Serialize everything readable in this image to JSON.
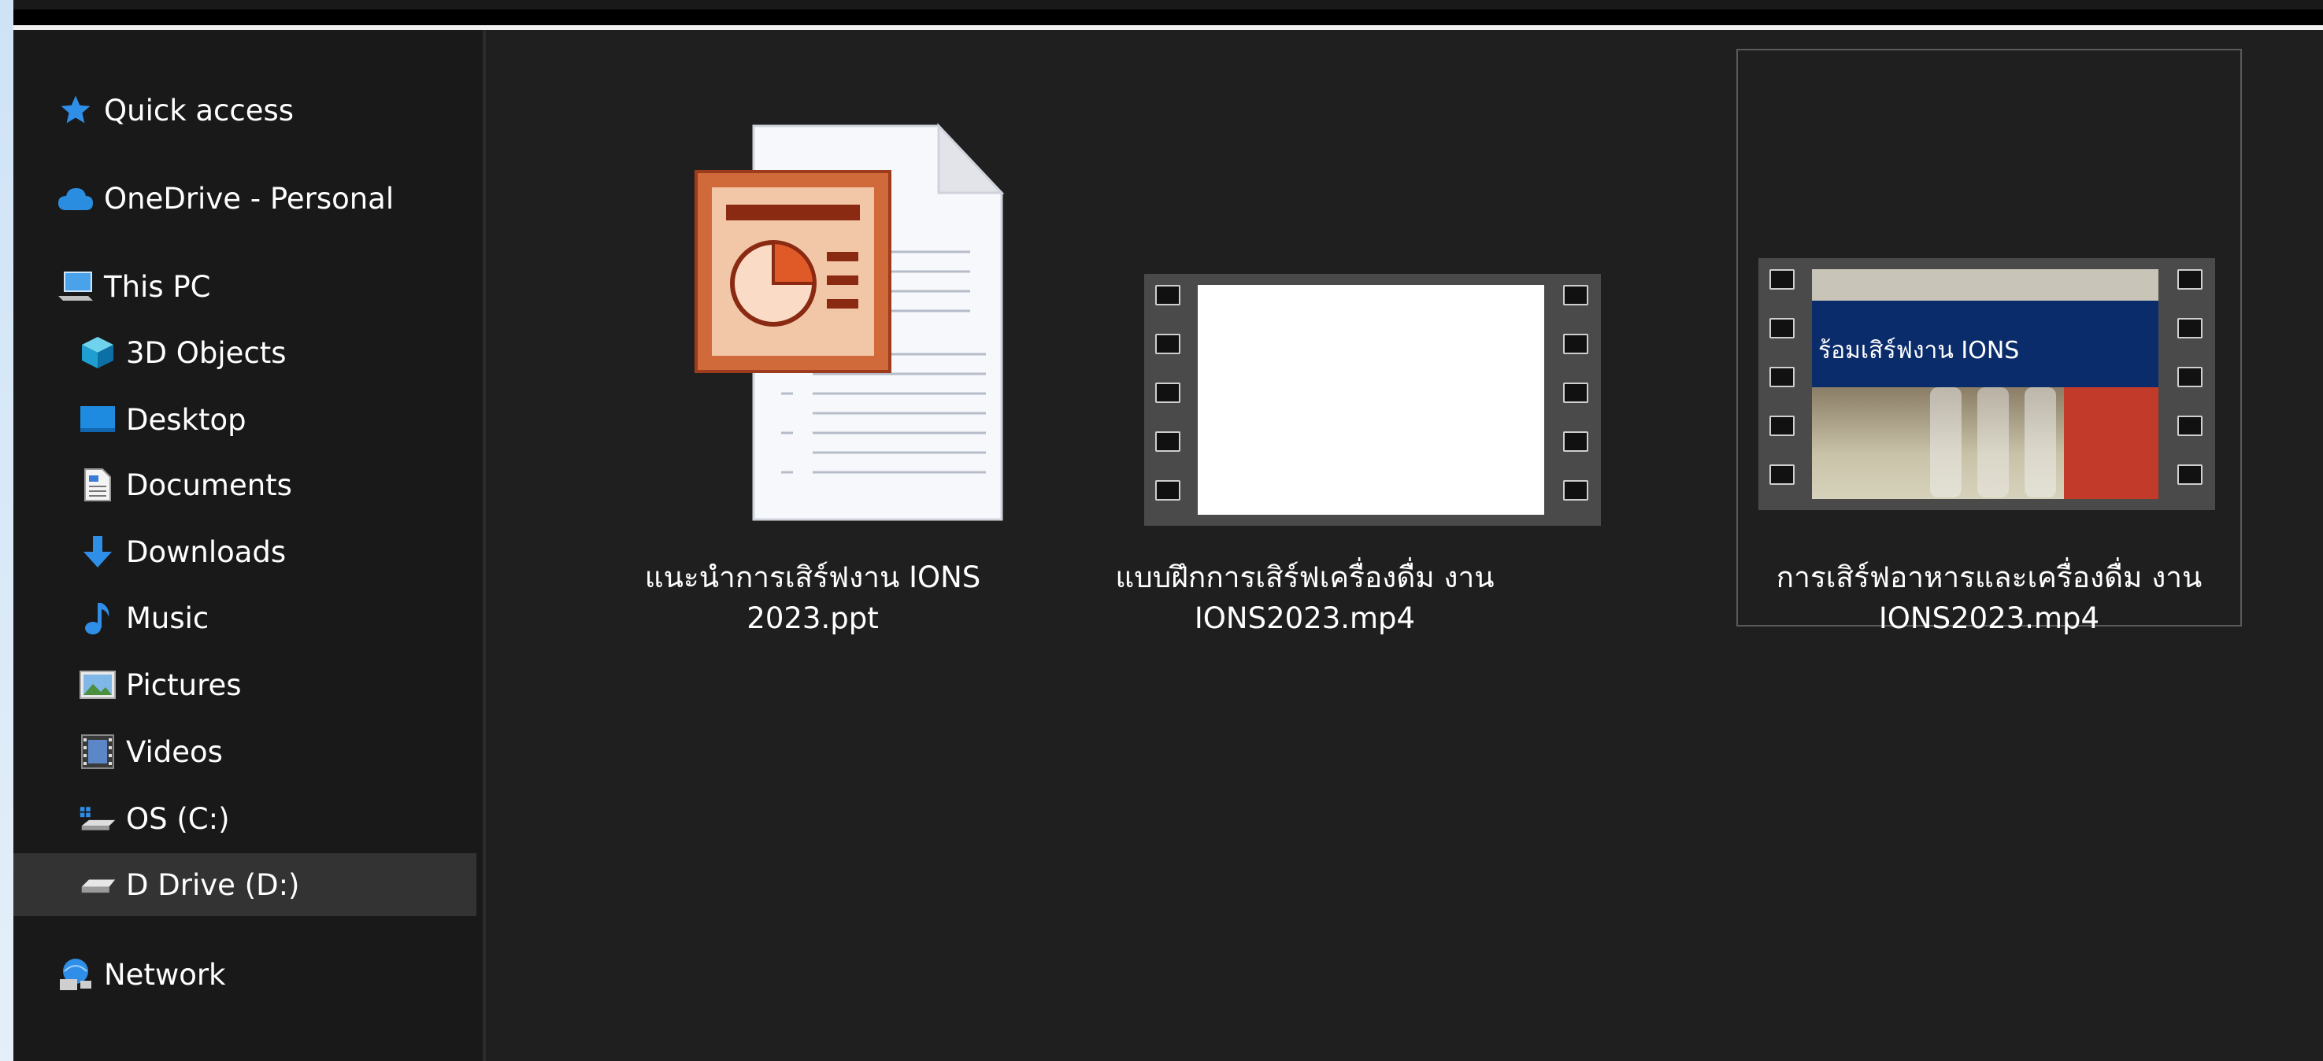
{
  "sidebar": {
    "items": [
      {
        "label": "Quick access",
        "icon": "star-icon"
      },
      {
        "label": "OneDrive - Personal",
        "icon": "cloud-icon"
      },
      {
        "label": "This PC",
        "icon": "computer-icon"
      },
      {
        "label": "3D Objects",
        "icon": "cube-icon"
      },
      {
        "label": "Desktop",
        "icon": "desktop-icon"
      },
      {
        "label": "Documents",
        "icon": "document-icon"
      },
      {
        "label": "Downloads",
        "icon": "download-arrow-icon"
      },
      {
        "label": "Music",
        "icon": "music-note-icon"
      },
      {
        "label": "Pictures",
        "icon": "picture-icon"
      },
      {
        "label": "Videos",
        "icon": "film-icon"
      },
      {
        "label": "OS (C:)",
        "icon": "os-drive-icon"
      },
      {
        "label": "D Drive (D:)",
        "icon": "drive-icon"
      },
      {
        "label": "Network",
        "icon": "network-icon"
      }
    ],
    "selected_index": 11
  },
  "files": [
    {
      "line1": "แนะนำการเสิร์ฟงาน IONS",
      "line2": "2023.ppt",
      "icon": "powerpoint-file-icon"
    },
    {
      "line1": "แบบฝึกการเสิร์ฟเครื่องดื่ม งาน",
      "line2": "IONS2023.mp4",
      "icon": "video-file-icon"
    },
    {
      "line1": "การเสิร์ฟอาหารและเครื่องดื่ม งาน",
      "line2": "IONS2023.mp4",
      "icon": "video-file-icon",
      "thumb_text": "ร้อมเสิร์ฟงาน IONS"
    }
  ],
  "colors": {
    "sidebar_bg": "#191919",
    "content_bg": "#1f1f1f",
    "selected_bg": "#333333",
    "accent_blue": "#1e90ff",
    "text": "#ffffff"
  }
}
